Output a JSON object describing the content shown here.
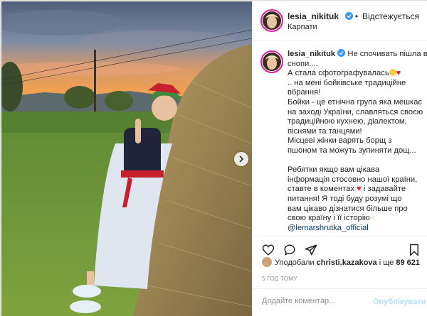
{
  "post": {
    "photo_alt": "",
    "carousel_next": "chevron-right-icon"
  },
  "header": {
    "username": "lesia_nikituk",
    "separator": "•",
    "follow_label": "Відстежується",
    "location": "Карпати"
  },
  "caption": {
    "username": "lesia_nikituk",
    "lines": [
      "Не спочивать пішла в",
      "снопи....",
      "А стала сфотографувалась",
      ".. на мені бойківське традиційне",
      "вбрання!",
      "Бойки - це етнічна група яка мешкає",
      "на заході України, славляться своєю",
      "традиційною кухнею, діалектом,",
      "піснями та танцями!",
      "Місцеві жінки варять борщ з",
      "пшоном та можуть зупиняти дощ...",
      "",
      "Ребятки якщо вам цікава",
      "інформація стосовно нашої країни,",
      "ставте в коментах",
      "і задавайте",
      "питання! Я тоді буду розумі що",
      "вам цікаво дізнатися більше про",
      "свою країну і її історію"
    ],
    "mention": "@lemarshrutka_official"
  },
  "likes": {
    "prefix": "Уподобали",
    "user": "christi.kazakova",
    "middle": "і ще",
    "count": "89 621"
  },
  "timestamp": "5 ГОД ТОМУ",
  "comment": {
    "placeholder": "Додайте коментар...",
    "publish_label": "Опублікувати"
  },
  "colors": {
    "accent": "#3897f0",
    "link": "#00376b",
    "muted": "#8e8e8e",
    "publish_disabled": "#b2dffc",
    "heart": "#ed1c24"
  }
}
